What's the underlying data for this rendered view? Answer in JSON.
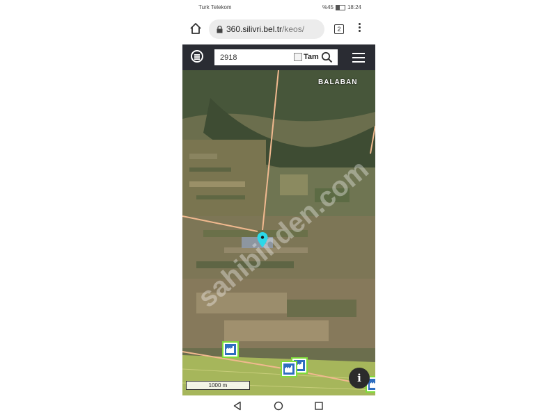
{
  "status_bar": {
    "carrier": "Turk Telekom",
    "battery": "%45",
    "time": "18:24"
  },
  "browser": {
    "url_host": "360.silivri.bel.tr",
    "url_path": "/keos/",
    "tab_count": "2"
  },
  "map_toolbar": {
    "search_value": "2918",
    "full_checkbox_label": "Tam",
    "full_checked": false
  },
  "map": {
    "place_label": "BALABAN",
    "scale_label": "1000 m",
    "info_label": "i",
    "watermark": "sahibinden.com"
  },
  "icons": {
    "home": "home-icon",
    "lock": "lock-icon",
    "tabs": "tabs-icon",
    "menu": "overflow-menu-icon",
    "layers": "layers-icon",
    "search": "search-icon",
    "hamburger": "hamburger-icon",
    "marker": "location-pin-icon",
    "factory": "factory-icon"
  },
  "colors": {
    "toolbar_bg": "#2a2c33",
    "marker": "#2cd8e8",
    "factory_fill": "#2f6ec0",
    "factory_border": "#7fdc3a",
    "boundary_line": "#f1b98f"
  }
}
